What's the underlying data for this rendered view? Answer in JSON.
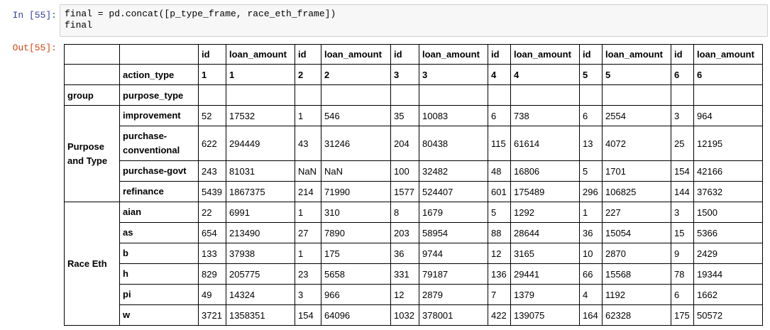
{
  "cell": {
    "in_prompt": "In [55]:",
    "out_prompt": "Out[55]:",
    "code_lines": [
      "final = pd.concat([p_type_frame, race_eth_frame])",
      "final"
    ]
  },
  "table": {
    "header_top": [
      "",
      "",
      "id",
      "loan_amount",
      "id",
      "loan_amount",
      "id",
      "loan_amount",
      "id",
      "loan_amount",
      "id",
      "loan_amount",
      "id",
      "loan_amount"
    ],
    "header_action": [
      "",
      "action_type",
      "1",
      "1",
      "2",
      "2",
      "3",
      "3",
      "4",
      "4",
      "5",
      "5",
      "6",
      "6"
    ],
    "header_group": [
      "group",
      "purpose_type",
      "",
      "",
      "",
      "",
      "",
      "",
      "",
      "",
      "",
      "",
      "",
      ""
    ],
    "groups": [
      {
        "label": "Purpose and Type",
        "rows": [
          {
            "label": "improvement",
            "values": [
              "52",
              "17532",
              "1",
              "546",
              "35",
              "10083",
              "6",
              "738",
              "6",
              "2554",
              "3",
              "964"
            ]
          },
          {
            "label": "purchase-conventional",
            "values": [
              "622",
              "294449",
              "43",
              "31246",
              "204",
              "80438",
              "115",
              "61614",
              "13",
              "4072",
              "25",
              "12195"
            ]
          },
          {
            "label": "purchase-govt",
            "values": [
              "243",
              "81031",
              "NaN",
              "NaN",
              "100",
              "32482",
              "48",
              "16806",
              "5",
              "1701",
              "154",
              "42166"
            ]
          },
          {
            "label": "refinance",
            "values": [
              "5439",
              "1867375",
              "214",
              "71990",
              "1577",
              "524407",
              "601",
              "175489",
              "296",
              "106825",
              "144",
              "37632"
            ]
          }
        ]
      },
      {
        "label": "Race Eth",
        "rows": [
          {
            "label": "aian",
            "values": [
              "22",
              "6991",
              "1",
              "310",
              "8",
              "1679",
              "5",
              "1292",
              "1",
              "227",
              "3",
              "1500"
            ]
          },
          {
            "label": "as",
            "values": [
              "654",
              "213490",
              "27",
              "7890",
              "203",
              "58954",
              "88",
              "28644",
              "36",
              "15054",
              "15",
              "5366"
            ]
          },
          {
            "label": "b",
            "values": [
              "133",
              "37938",
              "1",
              "175",
              "36",
              "9744",
              "12",
              "3165",
              "10",
              "2870",
              "9",
              "2429"
            ]
          },
          {
            "label": "h",
            "values": [
              "829",
              "205775",
              "23",
              "5658",
              "331",
              "79187",
              "136",
              "29441",
              "66",
              "15568",
              "78",
              "19344"
            ]
          },
          {
            "label": "pi",
            "values": [
              "49",
              "14324",
              "3",
              "966",
              "12",
              "2879",
              "7",
              "1379",
              "4",
              "1192",
              "6",
              "1662"
            ]
          },
          {
            "label": "w",
            "values": [
              "3721",
              "1358351",
              "154",
              "64096",
              "1032",
              "378001",
              "422",
              "139075",
              "164",
              "62328",
              "175",
              "50572"
            ]
          }
        ]
      }
    ]
  }
}
